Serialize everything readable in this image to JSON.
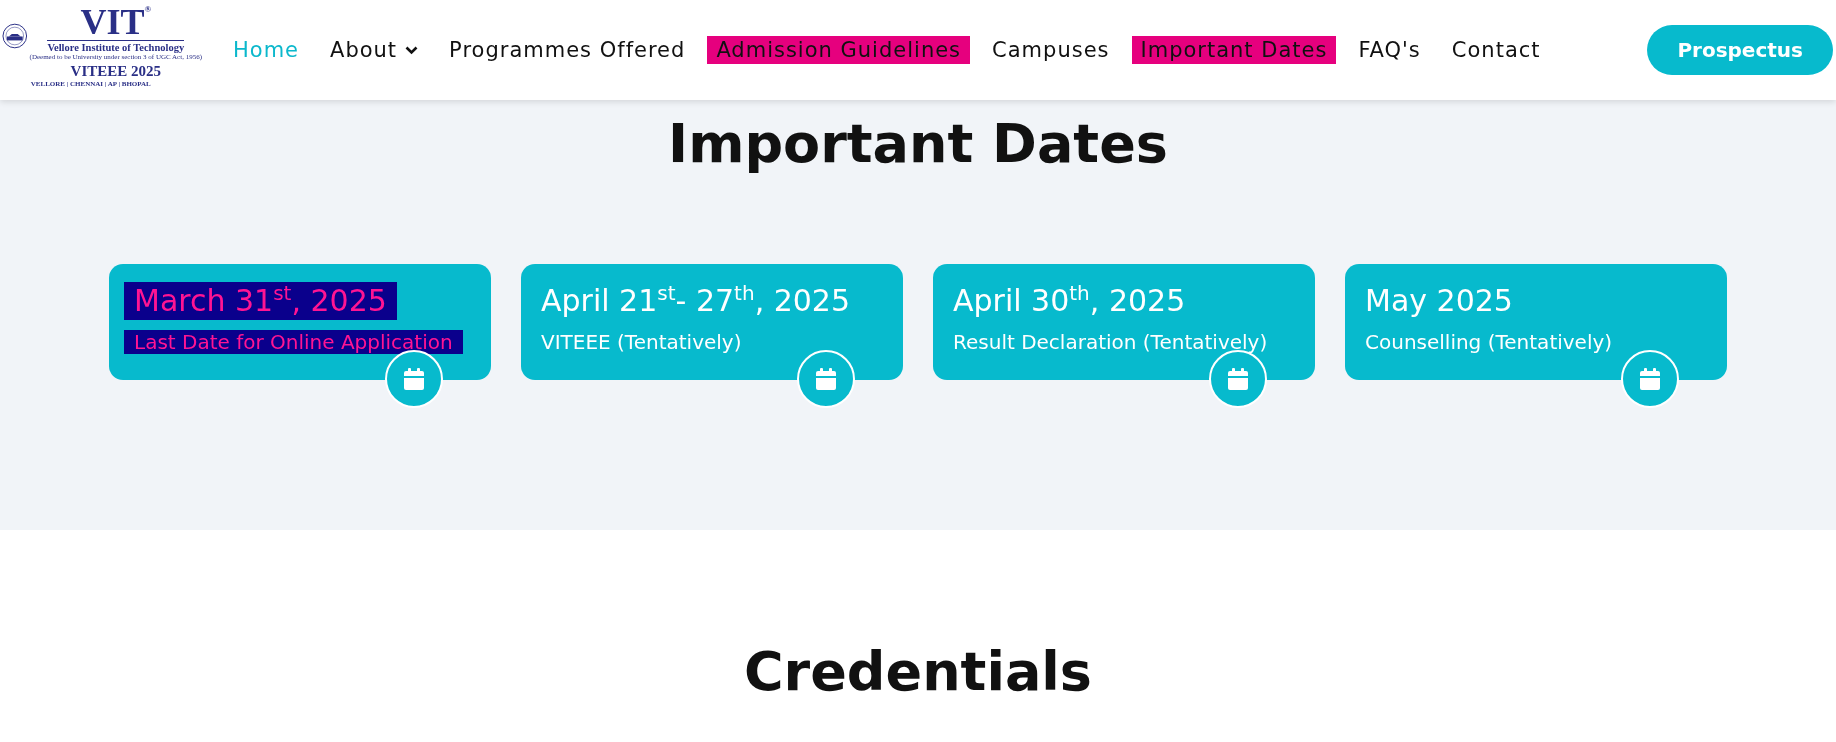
{
  "logo": {
    "title": "VIT",
    "mark": "®",
    "name": "Vellore Institute of Technology",
    "note": "(Deemed to be University under section 3 of UGC Act, 1956)",
    "exam": "VITEEE 2025",
    "campuses": "VELLORE | CHENNAI | AP | BHOPAL"
  },
  "nav": [
    {
      "label": "Home",
      "selected": true,
      "highlighted": false,
      "dropdown": false
    },
    {
      "label": "About",
      "selected": false,
      "highlighted": false,
      "dropdown": true
    },
    {
      "label": "Programmes Offered",
      "selected": false,
      "highlighted": false,
      "dropdown": false
    },
    {
      "label": "Admission Guidelines",
      "selected": false,
      "highlighted": true,
      "dropdown": false
    },
    {
      "label": "Campuses",
      "selected": false,
      "highlighted": false,
      "dropdown": false
    },
    {
      "label": "Important Dates",
      "selected": false,
      "highlighted": true,
      "dropdown": false
    },
    {
      "label": "FAQ's",
      "selected": false,
      "highlighted": false,
      "dropdown": false
    },
    {
      "label": "Contact",
      "selected": false,
      "highlighted": false,
      "dropdown": false
    }
  ],
  "cta": "Prospectus",
  "dates_section": {
    "title": "Important Dates",
    "cards": [
      {
        "date": "March 31$^{st}$, 2025",
        "event": "Last Date for Online Application",
        "highlighted": true
      },
      {
        "date": "April 21$^{st}$- 27$^{th}$, 2025",
        "event": "VITEEE (Tentatively)",
        "highlighted": false
      },
      {
        "date": "April 30$^{th}$, 2025",
        "event": "Result Declaration (Tentatively)",
        "highlighted": false
      },
      {
        "date": "May 2025",
        "event": "Counselling (Tentatively)",
        "highlighted": false
      }
    ]
  },
  "credentials_section": {
    "title": "Credentials"
  }
}
